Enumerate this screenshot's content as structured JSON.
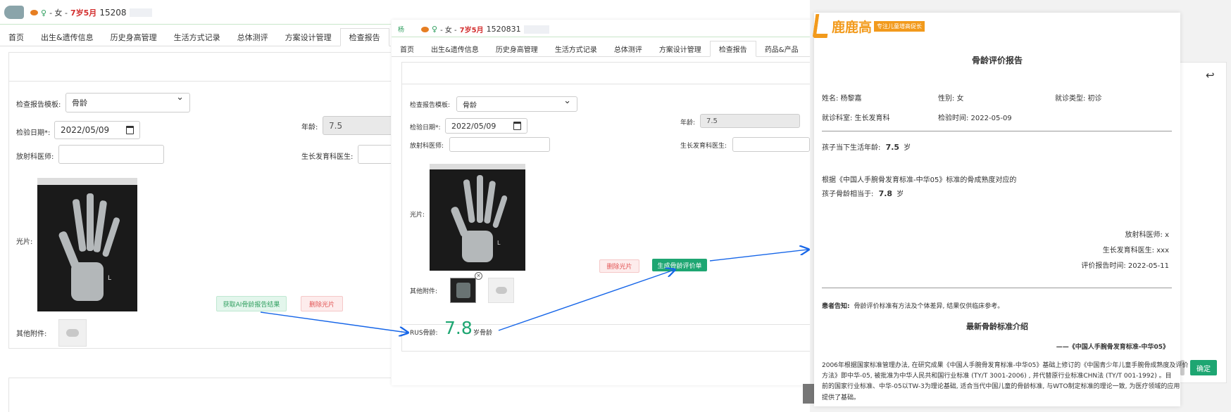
{
  "panel1": {
    "patient": {
      "sex": "- 女 -",
      "age": "7岁5月",
      "phone": "15208"
    },
    "tabs": [
      "首页",
      "出生&遗传信息",
      "历史身高管理",
      "生活方式记录",
      "总体测评",
      "方案设计管理",
      "检查报告"
    ],
    "form": {
      "template_label": "检查报告模板:",
      "template_value": "骨龄",
      "date_label": "检验日期*:",
      "date_value": "2022/05/09",
      "age_label": "年龄:",
      "age_value": "7.5",
      "radiologist_label": "放射科医师:",
      "growth_doctor_label": "生长发育科医生:",
      "xray_label": "光片:",
      "attachments_label": "其他附件:",
      "ai_button": "获取AI骨龄报告结果",
      "delete_button": "删除光片"
    }
  },
  "panel2": {
    "patient": {
      "name_prefix": "杨",
      "sex": "- 女 -",
      "age": "7岁5月",
      "phone": "1520831"
    },
    "tabs": [
      "首页",
      "出生&遗传信息",
      "历史身高管理",
      "生活方式记录",
      "总体测评",
      "方案设计管理",
      "检查报告",
      "药品&产品"
    ],
    "form": {
      "template_label": "检查报告模板:",
      "template_value": "骨龄",
      "date_label": "检验日期*:",
      "date_value": "2022/05/09",
      "age_label": "年龄:",
      "age_value": "7.5",
      "radiologist_label": "放射科医师:",
      "growth_doctor_label": "生长发育科医生:",
      "xray_label": "光片:",
      "attachments_label": "其他附件:",
      "delete_button": "删除光片",
      "generate_button": "生成骨龄评价单",
      "rus_label": "RUS骨龄:",
      "rus_value": "7.8",
      "rus_unit": "岁骨龄"
    }
  },
  "report": {
    "brand": "鹿鹿高",
    "brand_tag": "专注儿童增高促长",
    "title": "骨龄评价报告",
    "name": "姓名: 杨黎嘉",
    "sex": "性别: 女",
    "visit_type": "就诊类型: 初诊",
    "department": "就诊科室: 生长发育科",
    "exam_time": "检验时间: 2022-05-09",
    "current_age_label": "孩子当下生活年龄:",
    "current_age_value": "7.5",
    "current_age_unit": "岁",
    "standard_line": "根据《中国人手腕骨发育标准-中华05》标准的骨成熟度对应的",
    "bone_age_label": "孩子骨龄相当于:",
    "bone_age_value": "7.8",
    "bone_age_unit": "岁",
    "radiologist": "放射科医师: x",
    "growth_doctor": "生长发育科医生: xxx",
    "report_time": "评价报告时间: 2022-05-11",
    "notice_label": "患者告知:",
    "notice_text": "骨龄评价标准有方法及个体差异, 结果仅供临床参考。",
    "latest_title": "最新骨龄标准介绍",
    "latest_ref": "——《中国人手腕骨发育标准-中华05》",
    "paragraph_1": "2006年根据国家标准管理办法, 在研究成果《中国人手腕骨发育标准-中华05》基础上修订的《中国青少年儿童手腕骨成熟度及评价",
    "paragraph_2": "方法》即中华-05, 被批准为中华人民共和国行业标准 (TY/T 3001-2006) , 并代替原行业标准CHN法 (TY/T 001-1992) 。目",
    "paragraph_3": "前的国家行业标准、中华-05以TW-3为理论基础, 适合当代中国儿童的骨龄标准, 与WTO制定标准的理论一致, 为医疗领域的应用",
    "paragraph_4": "提供了基础。"
  },
  "dialog": {
    "confirm_button": "确定"
  },
  "colors": {
    "accent": "#1ea672",
    "arrow": "#1565e8",
    "danger": "#e25555",
    "brand": "#f29a1c"
  }
}
